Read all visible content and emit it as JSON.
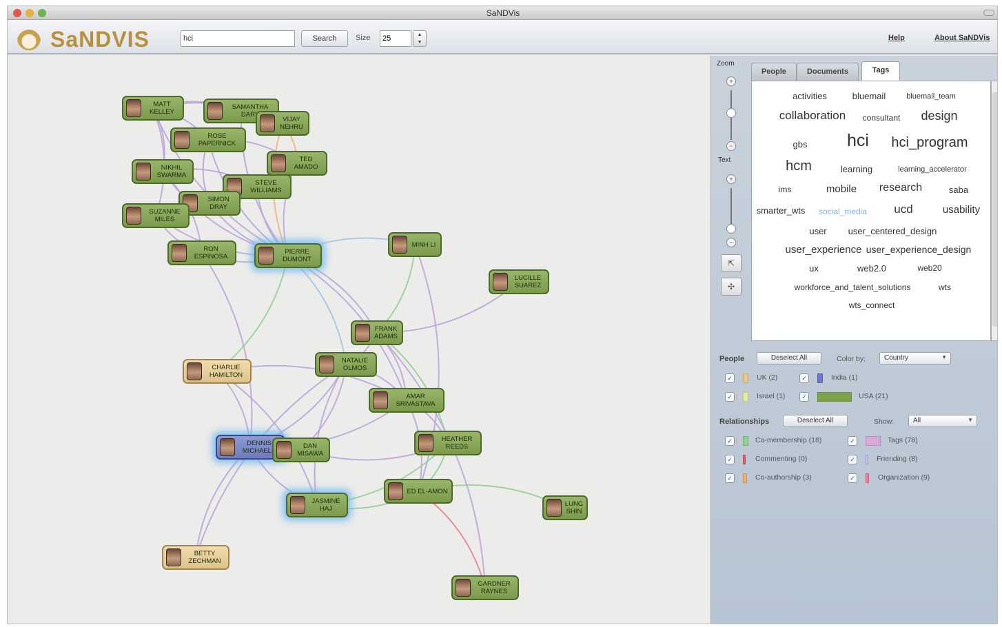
{
  "window": {
    "title": "SaNDVis"
  },
  "toolbar": {
    "logo": "SaNDVIS",
    "search_value": "hci",
    "search_button": "Search",
    "size_label": "Size",
    "size_value": "25",
    "help_link": "Help",
    "about_link": "About SaNDVis"
  },
  "graph": {
    "nodes": [
      {
        "id": "matt",
        "label": "MATT KELLEY",
        "style": "green",
        "glow": false
      },
      {
        "id": "samantha",
        "label": "SAMANTHA DARY",
        "style": "green",
        "glow": false
      },
      {
        "id": "vijay",
        "label": "VIJAY NEHRU",
        "style": "green",
        "glow": false
      },
      {
        "id": "rose",
        "label": "ROSE PAPERNICK",
        "style": "green",
        "glow": false
      },
      {
        "id": "ted",
        "label": "TED AMADO",
        "style": "green",
        "glow": false
      },
      {
        "id": "nikhil",
        "label": "NIKHIL SWARMA",
        "style": "green",
        "glow": false
      },
      {
        "id": "steve",
        "label": "STEVE WILLIAMS",
        "style": "green",
        "glow": false
      },
      {
        "id": "simon",
        "label": "SIMON DRAY",
        "style": "green",
        "glow": false
      },
      {
        "id": "suzanne",
        "label": "SUZANNE MILES",
        "style": "green",
        "glow": false
      },
      {
        "id": "ron",
        "label": "RON ESPINOSA",
        "style": "green",
        "glow": false
      },
      {
        "id": "pierre",
        "label": "PIERRE DUMONT",
        "style": "green",
        "glow": true
      },
      {
        "id": "minh",
        "label": "MINH LI",
        "style": "green",
        "glow": false
      },
      {
        "id": "lucille",
        "label": "LUCILLE SUAREZ",
        "style": "green",
        "glow": false
      },
      {
        "id": "frank",
        "label": "FRANK ADAMS",
        "style": "green",
        "glow": false
      },
      {
        "id": "charlie",
        "label": "CHARLIE HAMILTON",
        "style": "tan",
        "glow": false
      },
      {
        "id": "natalie",
        "label": "NATALIE OLMOS",
        "style": "green",
        "glow": false
      },
      {
        "id": "amar",
        "label": "AMAR SRIVASTAVA",
        "style": "green",
        "glow": false
      },
      {
        "id": "dennis",
        "label": "DENNIS MICHAELS",
        "style": "blue",
        "glow": true
      },
      {
        "id": "dan",
        "label": "DAN MISAWA",
        "style": "green",
        "glow": false
      },
      {
        "id": "heather",
        "label": "HEATHER REEDS",
        "style": "green",
        "glow": false
      },
      {
        "id": "ed",
        "label": "ED EL-AMON",
        "style": "green",
        "glow": false
      },
      {
        "id": "jasmine",
        "label": "JASMINE HAJ",
        "style": "green",
        "glow": true
      },
      {
        "id": "lung",
        "label": "LUNG SHIN",
        "style": "green",
        "glow": false
      },
      {
        "id": "betty",
        "label": "BETTY ZECHMAN",
        "style": "tan",
        "glow": false
      },
      {
        "id": "gardner",
        "label": "GARDNER RAYNES",
        "style": "green",
        "glow": false
      }
    ],
    "edges": [
      [
        "pierre",
        "matt",
        "purple"
      ],
      [
        "pierre",
        "samantha",
        "purple"
      ],
      [
        "pierre",
        "vijay",
        "orange"
      ],
      [
        "pierre",
        "rose",
        "purple"
      ],
      [
        "pierre",
        "ted",
        "purple"
      ],
      [
        "pierre",
        "nikhil",
        "purple"
      ],
      [
        "pierre",
        "steve",
        "purple"
      ],
      [
        "pierre",
        "simon",
        "purple"
      ],
      [
        "pierre",
        "suzanne",
        "purple"
      ],
      [
        "pierre",
        "ron",
        "purple"
      ],
      [
        "matt",
        "samantha",
        "purple"
      ],
      [
        "matt",
        "rose",
        "purple"
      ],
      [
        "matt",
        "nikhil",
        "purple"
      ],
      [
        "matt",
        "suzanne",
        "purple"
      ],
      [
        "samantha",
        "vijay",
        "purple"
      ],
      [
        "rose",
        "ted",
        "purple"
      ],
      [
        "nikhil",
        "steve",
        "purple"
      ],
      [
        "suzanne",
        "simon",
        "purple"
      ],
      [
        "ron",
        "suzanne",
        "purple"
      ],
      [
        "vijay",
        "ted",
        "orange"
      ],
      [
        "steve",
        "ted",
        "purple"
      ],
      [
        "simon",
        "rose",
        "purple"
      ],
      [
        "matt",
        "vijay",
        "purple"
      ],
      [
        "nikhil",
        "ron",
        "purple"
      ],
      [
        "pierre",
        "minh",
        "blue"
      ],
      [
        "pierre",
        "frank",
        "purple"
      ],
      [
        "pierre",
        "natalie",
        "blue"
      ],
      [
        "pierre",
        "charlie",
        "green"
      ],
      [
        "pierre",
        "amar",
        "purple"
      ],
      [
        "minh",
        "frank",
        "green"
      ],
      [
        "lucille",
        "frank",
        "purple"
      ],
      [
        "frank",
        "natalie",
        "purple"
      ],
      [
        "frank",
        "heather",
        "green"
      ],
      [
        "frank",
        "amar",
        "purple"
      ],
      [
        "natalie",
        "amar",
        "purple"
      ],
      [
        "natalie",
        "dan",
        "purple"
      ],
      [
        "natalie",
        "dennis",
        "purple"
      ],
      [
        "charlie",
        "dennis",
        "purple"
      ],
      [
        "charlie",
        "amar",
        "purple"
      ],
      [
        "amar",
        "dennis",
        "purple"
      ],
      [
        "amar",
        "heather",
        "purple"
      ],
      [
        "amar",
        "ed",
        "purple"
      ],
      [
        "heather",
        "ed",
        "green"
      ],
      [
        "heather",
        "dan",
        "purple"
      ],
      [
        "ed",
        "jasmine",
        "green"
      ],
      [
        "ed",
        "lung",
        "green"
      ],
      [
        "ed",
        "gardner",
        "pink"
      ],
      [
        "jasmine",
        "dennis",
        "purple"
      ],
      [
        "jasmine",
        "natalie",
        "purple"
      ],
      [
        "betty",
        "dennis",
        "purple"
      ],
      [
        "betty",
        "natalie",
        "purple"
      ],
      [
        "dan",
        "dennis",
        "blue"
      ],
      [
        "minh",
        "ed",
        "purple"
      ],
      [
        "ron",
        "dennis",
        "purple"
      ],
      [
        "charlie",
        "jasmine",
        "purple"
      ],
      [
        "frank",
        "gardner",
        "purple"
      ],
      [
        "heather",
        "jasmine",
        "green"
      ]
    ]
  },
  "panel": {
    "zoom_label": "Zoom",
    "text_label": "Text",
    "tabs": [
      "People",
      "Documents",
      "Tags"
    ],
    "active_tab": "Tags",
    "tags": [
      {
        "text": "activities",
        "size": 13
      },
      {
        "text": "bluemail",
        "size": 13
      },
      {
        "text": "bluemail_team",
        "size": 11
      },
      {
        "text": "collaboration",
        "size": 17
      },
      {
        "text": "consultant",
        "size": 12
      },
      {
        "text": "design",
        "size": 18
      },
      {
        "text": "gbs",
        "size": 13
      },
      {
        "text": "hci",
        "size": 25
      },
      {
        "text": "hci_program",
        "size": 20
      },
      {
        "text": "hcm",
        "size": 20
      },
      {
        "text": "learning",
        "size": 13
      },
      {
        "text": "learning_accelerator",
        "size": 11
      },
      {
        "text": "ims",
        "size": 12
      },
      {
        "text": "mobile",
        "size": 15
      },
      {
        "text": "research",
        "size": 16
      },
      {
        "text": "saba",
        "size": 13
      },
      {
        "text": "smarter_wts",
        "size": 13
      },
      {
        "text": "social_media",
        "size": 12,
        "hover": true
      },
      {
        "text": "ucd",
        "size": 17
      },
      {
        "text": "usability",
        "size": 15
      },
      {
        "text": "user",
        "size": 13
      },
      {
        "text": "user_centered_design",
        "size": 13
      },
      {
        "text": "user_experience",
        "size": 15
      },
      {
        "text": "user_experience_design",
        "size": 14
      },
      {
        "text": "ux",
        "size": 13
      },
      {
        "text": "web2.0",
        "size": 13
      },
      {
        "text": "web20",
        "size": 12
      },
      {
        "text": "workforce_and_talent_solutions",
        "size": 12
      },
      {
        "text": "wts",
        "size": 12
      },
      {
        "text": "wts_connect",
        "size": 12
      }
    ],
    "people": {
      "label": "People",
      "deselect": "Deselect All",
      "color_by_label": "Color by:",
      "color_by_value": "Country",
      "legend": [
        {
          "text": "UK (2)",
          "color": "#e8c98a"
        },
        {
          "text": "India (1)",
          "color": "#6c78c8"
        },
        {
          "text": "Israel (1)",
          "color": "#e5eda0"
        },
        {
          "text": "USA (21)",
          "color": "#7fa24c"
        }
      ]
    },
    "relationships": {
      "label": "Relationships",
      "deselect": "Deselect All",
      "show_label": "Show:",
      "show_value": "All",
      "legend": [
        {
          "text": "Co-membership (18)",
          "color": "#8fd08f"
        },
        {
          "text": "Tags (78)",
          "color": "#d7a9d9"
        },
        {
          "text": "Commenting (0)",
          "color": "#e06060"
        },
        {
          "text": "Friending (8)",
          "color": "#b9c3f0"
        },
        {
          "text": "Co-authorship (3)",
          "color": "#f0b070"
        },
        {
          "text": "Organization (9)",
          "color": "#e87c92"
        }
      ]
    }
  }
}
